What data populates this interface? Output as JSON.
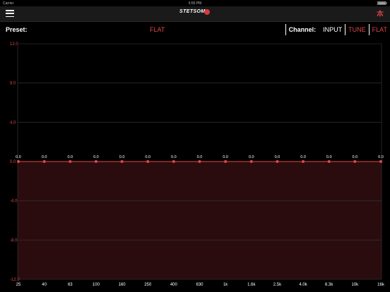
{
  "status_bar": {
    "carrier": "Carrier",
    "time": "5:55 PM"
  },
  "navbar": {
    "logo_text": "STETSOM"
  },
  "toolbar": {
    "preset_label": "Preset:",
    "preset_value": "FLAT",
    "channel_label": "Channel:",
    "channels": [
      "INPUT",
      "TUNE",
      "FLAT"
    ],
    "active_channel": "INPUT"
  },
  "chart_data": {
    "type": "line",
    "title": "",
    "xlabel": "",
    "ylabel": "",
    "categories": [
      "25",
      "40",
      "63",
      "100",
      "160",
      "250",
      "400",
      "630",
      "1k",
      "1.6k",
      "2.5k",
      "4.0k",
      "6.3k",
      "10k",
      "16k"
    ],
    "series": [
      {
        "values": [
          0,
          0,
          0,
          0,
          0,
          0,
          0,
          0,
          0,
          0,
          0,
          0,
          0,
          0,
          0
        ]
      }
    ],
    "point_labels": [
      "0.0",
      "0.0",
      "0.0",
      "0.0",
      "0.0",
      "0.0",
      "0.0",
      "0.0",
      "0.0",
      "0.0",
      "0.0",
      "0.0",
      "0.0",
      "0.0",
      "0.0"
    ],
    "ylim": [
      -12,
      12
    ],
    "yticks": [
      12,
      8,
      4,
      0,
      -4,
      -8,
      -12
    ],
    "ytick_labels": [
      "12.0",
      "8.0",
      "4.0",
      "0.0",
      "-4.0",
      "-8.0",
      "-12.0"
    ],
    "grid": true,
    "colors": {
      "line": "#e0474c",
      "point": "#e0474c",
      "fill_below": "#2b0c0e",
      "grid": "#2c2c2c",
      "tick_label": "#e0474c"
    }
  }
}
